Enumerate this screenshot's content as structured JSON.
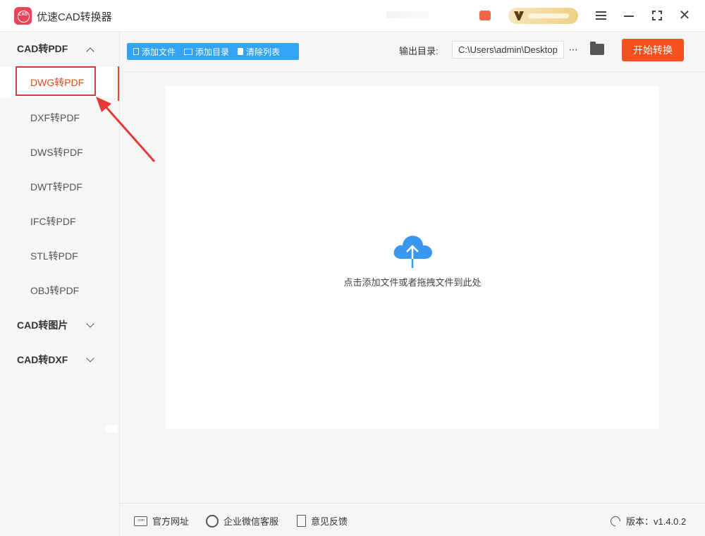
{
  "app": {
    "title": "优速CAD转换器",
    "logo_text": "CAD"
  },
  "colors": {
    "accent": "#f4511e",
    "active_nav": "#e64a19",
    "toolbar_blue": "#34a2f5",
    "annotation_red": "#e53935",
    "cloud_blue": "#3a97f0"
  },
  "sidebar": {
    "groups": [
      {
        "label": "CAD转PDF",
        "expanded": true,
        "items": [
          {
            "label": "DWG转PDF",
            "active": true
          },
          {
            "label": "DXF转PDF"
          },
          {
            "label": "DWS转PDF"
          },
          {
            "label": "DWT转PDF"
          },
          {
            "label": "IFC转PDF"
          },
          {
            "label": "STL转PDF"
          },
          {
            "label": "OBJ转PDF"
          }
        ]
      },
      {
        "label": "CAD转图片",
        "expanded": false
      },
      {
        "label": "CAD转DXF",
        "expanded": false
      }
    ]
  },
  "toolbar": {
    "add_file": "添加文件",
    "add_folder": "添加目录",
    "clear_list": "清除列表",
    "output_dir_label": "输出目录:",
    "output_dir_value": "C:\\Users\\admin\\Desktop",
    "more": "···",
    "start": "开始转换"
  },
  "drop_area": {
    "hint": "点击添加文件或者拖拽文件到此处",
    "icon": "cloud-upload-icon"
  },
  "footer": {
    "website": "官方网址",
    "wechat_service": "企业微信客服",
    "feedback": "意见反馈",
    "version": "版本：v1.4.0.2",
    "web_icon_text": ".com"
  }
}
